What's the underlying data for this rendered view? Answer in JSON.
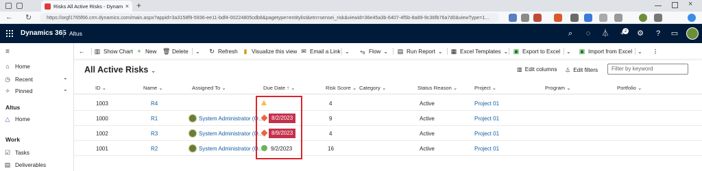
{
  "browser": {
    "tab_title": "Risks All Active Risks - Dynamics",
    "tab_close": "×",
    "new_tab": "+",
    "url": "https://orgf1765f66.crm.dynamics.com/main.aspx?appid=3a3158f9-5936-ee11-bdf4-00224805cdb8&pagetype=entitylist&etn=sensei_risk&viewid=36e45a3b-6407-4f5b-8a89-9c36fb76a7d0&viewType=1..."
  },
  "app": {
    "name": "Dynamics 365",
    "environment": "Altus",
    "notification_count": "2"
  },
  "sidebar": {
    "items_top": [
      {
        "icon": "⌂",
        "label": "Home"
      },
      {
        "icon": "◷",
        "label": "Recent",
        "chevron": "⌄"
      },
      {
        "icon": "✧",
        "label": "Pinned",
        "chevron": "⌄"
      }
    ],
    "section_altus": "Altus",
    "altus_items": [
      {
        "icon": "△",
        "label": "Home"
      }
    ],
    "section_work": "Work",
    "work_items": [
      {
        "icon": "☑",
        "label": "Tasks"
      },
      {
        "icon": "▤",
        "label": "Deliverables"
      }
    ]
  },
  "commands": {
    "back": "←",
    "show_chart": "Show Chart",
    "new": "New",
    "delete": "Delete",
    "refresh": "Refresh",
    "visualize": "Visualize this view",
    "email_link": "Email a Link",
    "flow": "Flow",
    "run_report": "Run Report",
    "excel_templates": "Excel Templates",
    "export_excel": "Export to Excel",
    "import_excel": "Import from Excel",
    "more": "⋮"
  },
  "view": {
    "title": "All Active Risks",
    "edit_columns": "Edit columns",
    "edit_filters": "Edit filters",
    "filter_placeholder": "Filter by keyword"
  },
  "columns": [
    "ID",
    "Name",
    "Assigned To",
    "Due Date",
    "Risk Score",
    "Category",
    "Status Reason",
    "Project",
    "Program",
    "Portfolio"
  ],
  "sort_indicator": "↑",
  "rows": [
    {
      "id": "1003",
      "name": "R4",
      "assigned": "",
      "due": "",
      "due_flag": "warning",
      "score": "4",
      "status": "Active",
      "project": "Project 01"
    },
    {
      "id": "1000",
      "name": "R1",
      "assigned": "System Administrator (O...",
      "due": "8/2/2023",
      "due_flag": "overdue",
      "score": "9",
      "status": "Active",
      "project": "Project 01"
    },
    {
      "id": "1002",
      "name": "R3",
      "assigned": "System Administrator (O...",
      "due": "8/9/2023",
      "due_flag": "overdue",
      "score": "4",
      "status": "Active",
      "project": "Project 01"
    },
    {
      "id": "1001",
      "name": "R2",
      "assigned": "System Administrator (O...",
      "due": "9/2/2023",
      "due_flag": "ok",
      "score": "16",
      "status": "Active",
      "project": "Project 01"
    }
  ],
  "colors": {
    "overdue": "#c4314b",
    "warning": "#f2c04d",
    "ok": "#6bb35a",
    "link": "#115ea3",
    "header": "#001b3a"
  }
}
